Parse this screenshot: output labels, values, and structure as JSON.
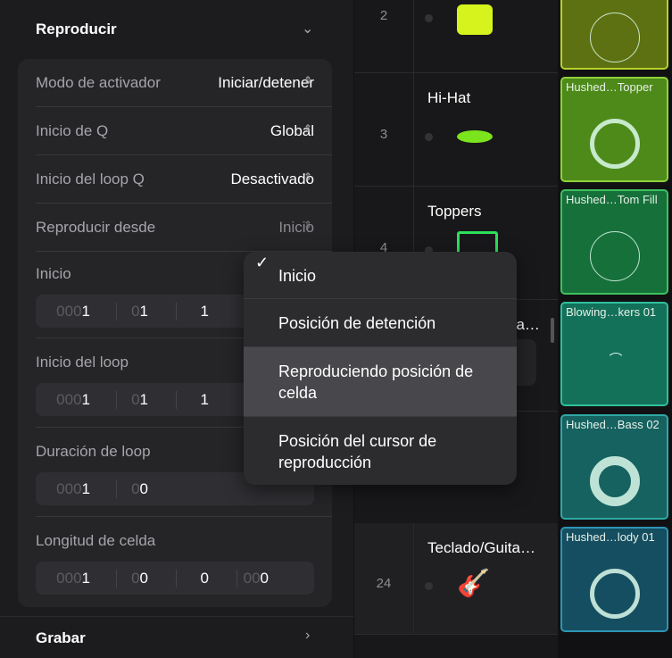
{
  "left": {
    "title": "Reproducir",
    "rows": [
      {
        "label": "Modo de activador",
        "value": "Iniciar/detener"
      },
      {
        "label": "Inicio de Q",
        "value": "Global"
      },
      {
        "label": "Inicio del loop Q",
        "value": "Desactivado"
      },
      {
        "label": "Reproducir desde",
        "value": "Inicio"
      }
    ],
    "fields": [
      {
        "label": "Inicio",
        "segs": [
          [
            "000",
            "1"
          ],
          [
            "0",
            "1"
          ],
          [
            "",
            "1"
          ]
        ]
      },
      {
        "label": "Inicio del loop",
        "segs": [
          [
            "000",
            "1"
          ],
          [
            "0",
            "1"
          ],
          [
            "",
            "1"
          ]
        ]
      },
      {
        "label": "Duración de loop",
        "segs": [
          [
            "000",
            "1"
          ],
          [
            "0",
            "0"
          ]
        ]
      },
      {
        "label": "Longitud de celda",
        "segs": [
          [
            "000",
            "1"
          ],
          [
            "0",
            "0"
          ],
          [
            "",
            "0"
          ],
          [
            "00",
            "0"
          ]
        ]
      }
    ],
    "record": "Grabar"
  },
  "menu": {
    "items": [
      {
        "label": "Inicio",
        "checked": true
      },
      {
        "label": "Posición de detención"
      },
      {
        "label": "Reproduciendo posición de celda",
        "highlighted": true
      },
      {
        "label": "Posición del cursor de reproducción"
      }
    ]
  },
  "tracks": [
    {
      "num": "2",
      "name": "",
      "icon": "snare-drum-icon"
    },
    {
      "num": "3",
      "name": "Hi-Hat",
      "icon": "hi-hat-icon"
    },
    {
      "num": "4",
      "name": "Toppers",
      "icon": "drum-machine-icon"
    },
    {
      "num": "",
      "name": "…ea…",
      "icon": ""
    },
    {
      "num": "24",
      "name": "Teclado/Guita…",
      "icon": "acoustic-guitar-icon"
    }
  ],
  "cells": [
    {
      "name": "",
      "color": "#5e7112",
      "border": "#b7d12a"
    },
    {
      "name": "Hushed…Topper",
      "color": "#4e8a1a",
      "border": "#8fd23a"
    },
    {
      "name": "Hushed…Tom Fill",
      "color": "#16703a",
      "border": "#3fc260"
    },
    {
      "name": "Blowing…kers 01",
      "color": "#137059",
      "border": "#2fc09a"
    },
    {
      "name": "Hushed…Bass 02",
      "color": "#166261",
      "border": "#2fa8a6"
    },
    {
      "name": "Hushed…lody 01",
      "color": "#154e60",
      "border": "#2d95b5"
    }
  ]
}
